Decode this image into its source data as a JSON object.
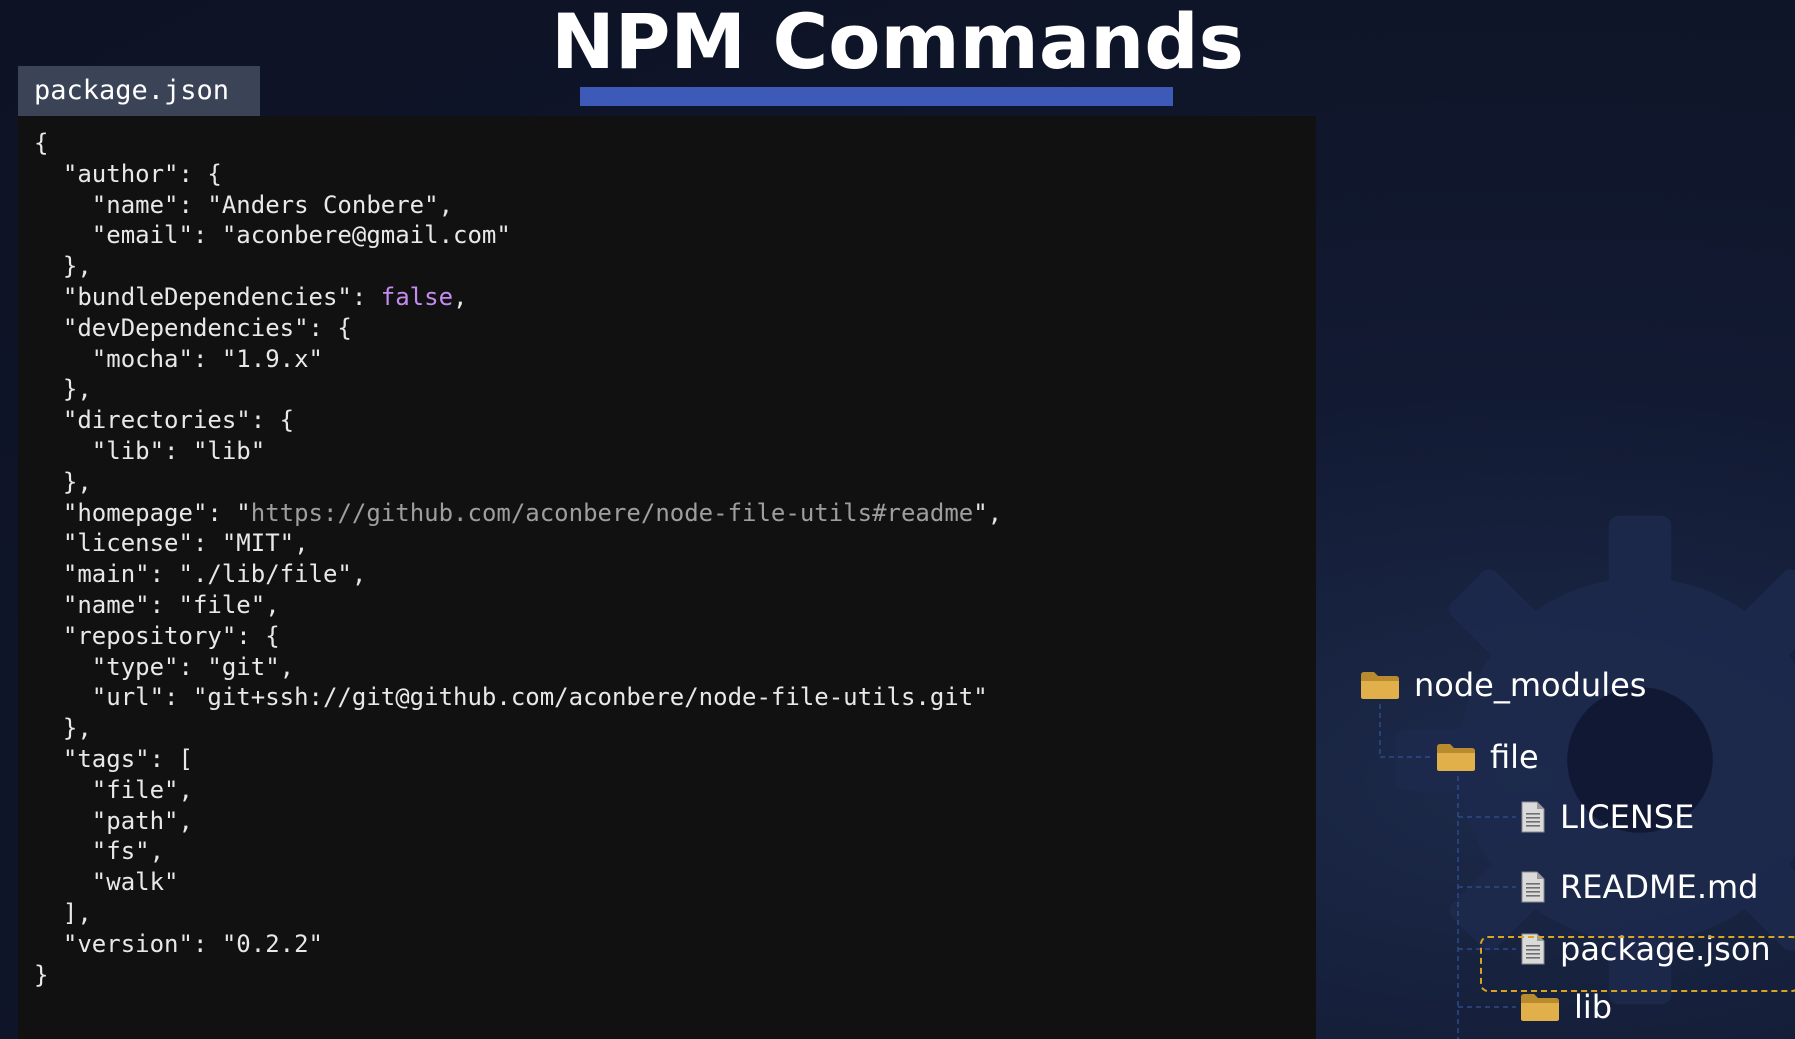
{
  "slide": {
    "title": "NPM Commands",
    "accent_color": "#3d5ab8"
  },
  "editor": {
    "file_tab": "package.json",
    "lines": [
      "{",
      "  \"author\": {",
      "    \"name\": \"Anders Conbere\",",
      "    \"email\": \"aconbere@gmail.com\"",
      "  },",
      "  \"bundleDependencies\": false,",
      "  \"devDependencies\": {",
      "    \"mocha\": \"1.9.x\"",
      "  },",
      "  \"directories\": {",
      "    \"lib\": \"lib\"",
      "  },",
      "  \"homepage\": \"https://github.com/aconbere/node-file-utils#readme\",",
      "  \"license\": \"MIT\",",
      "  \"main\": \"./lib/file\",",
      "  \"name\": \"file\",",
      "  \"repository\": {",
      "    \"type\": \"git\",",
      "    \"url\": \"git+ssh://git@github.com/aconbere/node-file-utils.git\"",
      "  },",
      "  \"tags\": [",
      "    \"file\",",
      "    \"path\",",
      "    \"fs\",",
      "    \"walk\"",
      "  ],",
      "  \"version\": \"0.2.2\"",
      "}"
    ],
    "highlight_colors": {
      "boolean": "#c58cf0",
      "url": "#9e9e9e"
    }
  },
  "file_tree": {
    "nodes": [
      {
        "label": "node_modules",
        "type": "folder",
        "icon": "folder-icon"
      },
      {
        "label": "file",
        "type": "folder",
        "icon": "folder-icon"
      },
      {
        "label": "LICENSE",
        "type": "file",
        "icon": "file-icon"
      },
      {
        "label": "README.md",
        "type": "file",
        "icon": "file-icon"
      },
      {
        "label": "package.json",
        "type": "file",
        "icon": "file-icon",
        "selected": true
      },
      {
        "label": "lib",
        "type": "folder",
        "icon": "folder-icon"
      }
    ],
    "folder_color": "#e2b04a",
    "selection_color": "#d9a521"
  }
}
